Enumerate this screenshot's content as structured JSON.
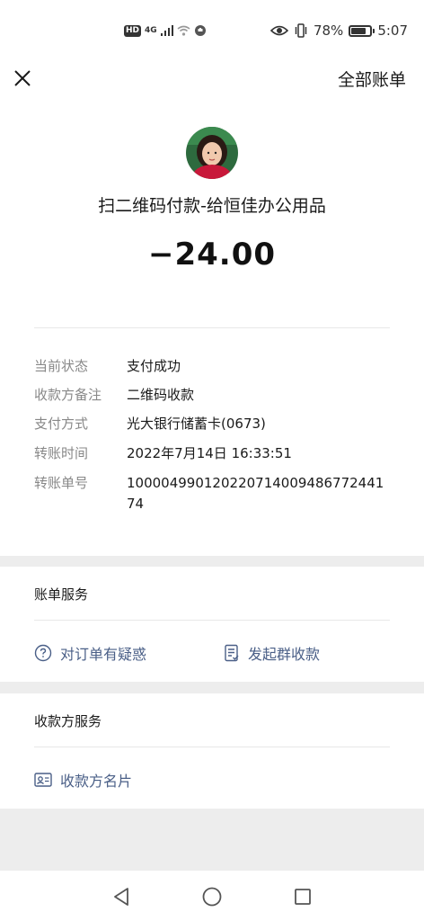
{
  "status_bar": {
    "hd_label": "HD",
    "network": "4G",
    "battery_percent": "78%",
    "battery_level": 0.78,
    "time": "5:07"
  },
  "nav": {
    "all_bills_label": "全部账单"
  },
  "transaction": {
    "title": "扫二维码付款-给恒佳办公用品",
    "amount": "−24.00",
    "details": [
      {
        "label": "当前状态",
        "value": "支付成功"
      },
      {
        "label": "收款方备注",
        "value": "二维码收款"
      },
      {
        "label": "支付方式",
        "value": "光大银行储蓄卡(0673)"
      },
      {
        "label": "转账时间",
        "value": "2022年7月14日 16:33:51"
      },
      {
        "label": "转账单号",
        "value": "100004990120220714009486772441 74"
      }
    ]
  },
  "bill_services": {
    "title": "账单服务",
    "question_label": "对订单有疑惑",
    "group_collect_label": "发起群收款"
  },
  "payee_services": {
    "title": "收款方服务",
    "card_label": "收款方名片"
  },
  "colors": {
    "link": "#4a5f87",
    "background": "#ededed"
  }
}
